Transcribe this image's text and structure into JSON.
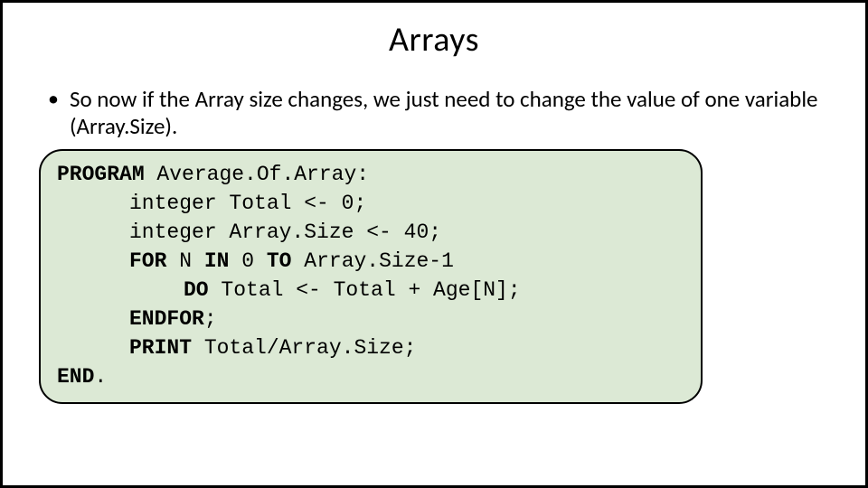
{
  "title": "Arrays",
  "bullet": "So now if the Array size changes, we just need to change the value of one variable (Array.Size).",
  "code": {
    "kw_program": "PROGRAM",
    "program_name": " Average.Of.Array:",
    "line_total": "integer Total <- 0;",
    "line_arraysize": "integer Array.Size <- 40;",
    "kw_for": "FOR",
    "for_mid1": " N ",
    "kw_in": "IN",
    "for_mid2": " 0 ",
    "kw_to": "TO",
    "for_tail": " Array.Size-1",
    "kw_do": "DO",
    "do_tail": "  Total <- Total + Age[N];",
    "kw_endfor": "ENDFOR",
    "endfor_tail": ";",
    "kw_print": "PRINT",
    "print_tail": " Total/Array.Size;",
    "kw_end": "END",
    "end_tail": "."
  }
}
